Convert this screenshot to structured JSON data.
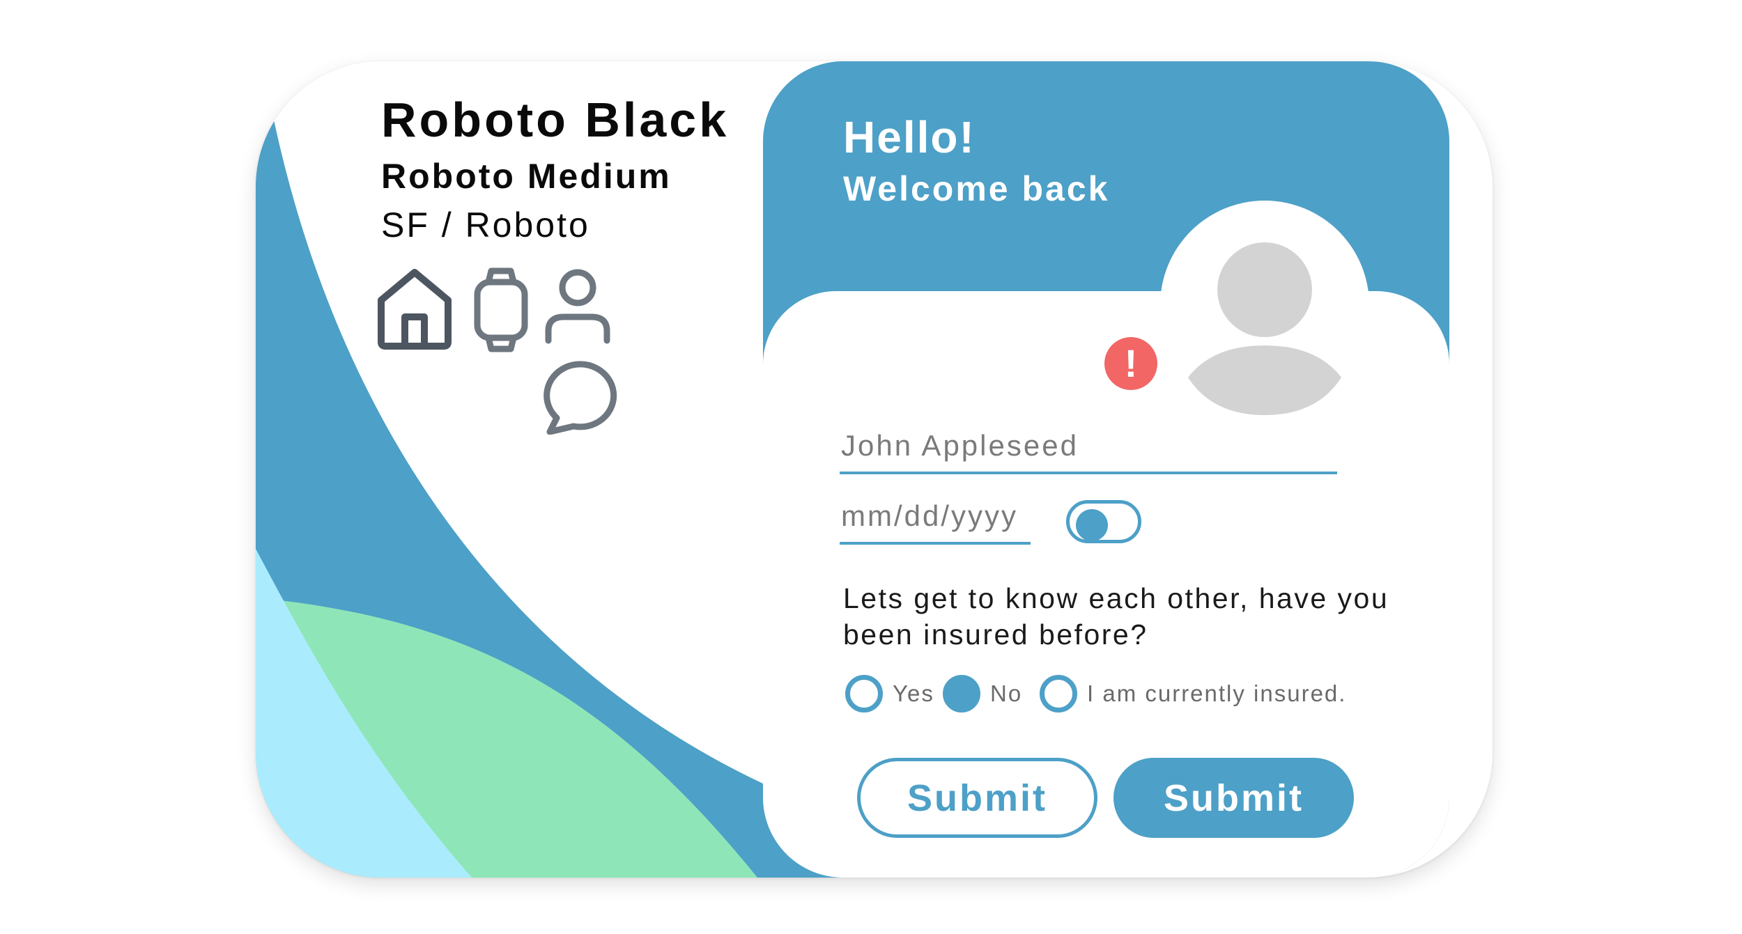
{
  "colors": {
    "primary": "#4da0c7",
    "mint": "#8ee6b8",
    "light_blue": "#aaecfe",
    "alert": "#f26666",
    "icon_gray": "#4d5660",
    "avatar_gray": "#d3d3d3"
  },
  "typography": {
    "black_label": "Roboto Black",
    "medium_label": "Roboto Medium",
    "regular_label": "SF / Roboto"
  },
  "icons": [
    "home-icon",
    "watch-icon",
    "person-icon",
    "chat-icon"
  ],
  "form": {
    "hello": "Hello!",
    "welcome": "Welcome back",
    "alert_icon": "alert-icon",
    "alert_glyph": "!",
    "name_placeholder": "John Appleseed",
    "date_placeholder": "mm/dd/yyyy",
    "toggle_on": true,
    "question": "Lets get to know each other, have you been insured before?",
    "options": [
      {
        "label": "Yes",
        "checked": false
      },
      {
        "label": "No",
        "checked": true
      },
      {
        "label": "I am currently insured.",
        "checked": false
      }
    ],
    "submit_outline_label": "Submit",
    "submit_filled_label": "Submit"
  }
}
